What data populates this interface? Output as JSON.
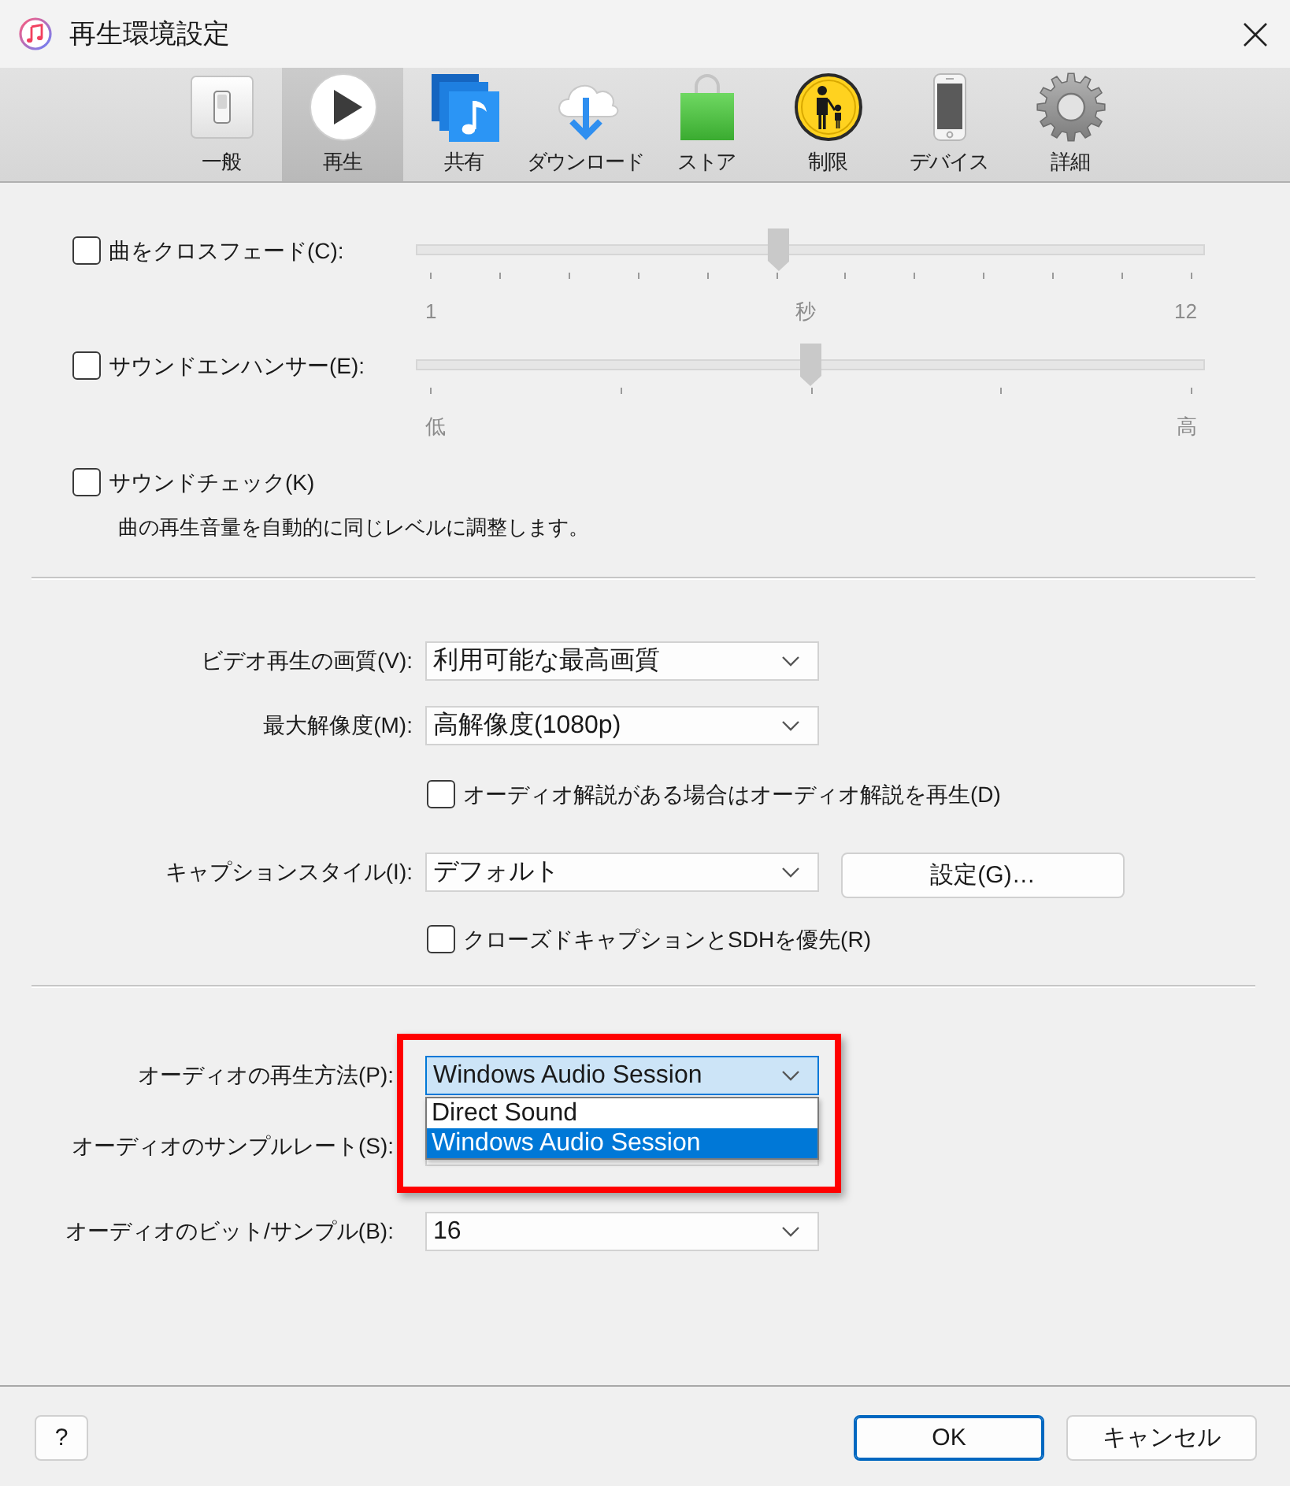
{
  "window": {
    "title": "再生環境設定"
  },
  "tabs": [
    {
      "kind": "general",
      "label": "一般",
      "selected": false
    },
    {
      "kind": "playback",
      "label": "再生",
      "selected": true
    },
    {
      "kind": "sharing",
      "label": "共有",
      "selected": false
    },
    {
      "kind": "download",
      "label": "ダウンロード",
      "selected": false
    },
    {
      "kind": "store",
      "label": "ストア",
      "selected": false
    },
    {
      "kind": "restrictions",
      "label": "制限",
      "selected": false
    },
    {
      "kind": "devices",
      "label": "デバイス",
      "selected": false
    },
    {
      "kind": "advanced",
      "label": "詳細",
      "selected": false
    }
  ],
  "audio_effects": {
    "sliders": [
      {
        "kind": "seconds",
        "label": "曲をクロスフェード(C):",
        "checked": false,
        "level": 0.46,
        "scale": [
          "1",
          "秒",
          "12"
        ]
      },
      {
        "kind": "strength",
        "label": "サウンドエンハンサー(E):",
        "checked": false,
        "level": 0.5,
        "scale": [
          "低",
          "高"
        ]
      }
    ],
    "sound_check": {
      "label": "サウンドチェック(K)",
      "checked": false,
      "description": "曲の再生音量を自動的に同じレベルに調整します。"
    }
  },
  "video": [
    {
      "kind": "select",
      "label": "ビデオ再生の画質(V):",
      "value": "利用可能な最高画質"
    },
    {
      "kind": "select",
      "label": "最大解像度(M):",
      "value": "高解像度(1080p)"
    },
    {
      "kind": "checkbox",
      "label": "オーディオ解説がある場合はオーディオ解説を再生(D)",
      "checked": false
    },
    {
      "kind": "select_button",
      "label": "キャプションスタイル(I):",
      "value": "デフォルト",
      "button": "設定(G)…"
    },
    {
      "kind": "checkbox",
      "label": "クローズドキャプションとSDHを優先(R)",
      "checked": false
    }
  ],
  "audio": [
    {
      "label": "オーディオの再生方法(P):",
      "value": "Windows Audio Session",
      "expanded": true,
      "highlighted": true,
      "options": [
        {
          "label": "Direct Sound",
          "selected": false
        },
        {
          "label": "Windows Audio Session",
          "selected": true
        }
      ]
    },
    {
      "label": "オーディオのサンプルレート(S):",
      "expanded": false,
      "highlighted": false
    },
    {
      "label": "オーディオのビット/サンプル(B):",
      "value": "16",
      "expanded": false,
      "highlighted": false
    }
  ],
  "footer": {
    "help": "?",
    "buttons": [
      {
        "label": "OK",
        "default": true
      },
      {
        "label": "キャンセル",
        "default": false
      }
    ]
  }
}
